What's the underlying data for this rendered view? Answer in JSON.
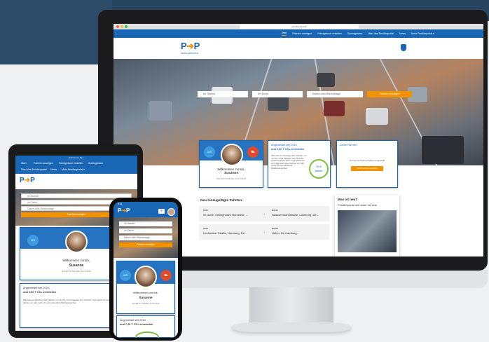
{
  "colors": {
    "brand_blue": "#1967b4",
    "accent_orange": "#f39200",
    "eco_green": "#7cbf3a"
  },
  "desktop": {
    "url": "pendlerportal.de",
    "nav": [
      "Start",
      "Fahrten anzeigen",
      "Fahrtgesuch erstellen",
      "Suchagenten",
      "Über das Pendlerportal",
      "News",
      "Mein Pendlerportal ▾"
    ],
    "logo": {
      "text_left": "P",
      "text_arrow": "➔",
      "text_right": "P",
      "sub": "PENDLERPORTAL"
    },
    "search": {
      "from_placeholder": "Ihr Startort",
      "to_placeholder": "Ihr Zielort",
      "date_placeholder": "Datum oder Wochentage",
      "button": "Fahrten anzeigen"
    },
    "welcome": {
      "greeting": "Willkommen zurück,",
      "name": "Susanne",
      "last_online": "ZULETZT ONLINE: 22.10.2019"
    },
    "eco": {
      "line1": "Angemeldet seit 2016",
      "line2": "und 0,00 T CO₂ vermieden",
      "body": "Was hast du zukünftig mehr Fahrten, um mit CO₂ zu für tätigsten zum Verzeiht jemals verfolgen kann. Lege gleich los und trage beim einer Fahrten ein oder suche dir eine passende Mitfahrgelegenheit.",
      "circle_top": "2019",
      "circle_bottom": "starten"
    },
    "my_trips": {
      "title": "Deine Fahrten",
      "empty": "Zu has noch keine Fahrten eingestellt",
      "button": "2019 Fahrten erstellen"
    },
    "new_trips": {
      "title": "Neu hinzugefügte Fahrten:",
      "rows": [
        {
          "from_label": "VON",
          "from": "im Dorfe, Kellinghusen Barnstedt, ...",
          "to_label": "NACH",
          "to": "Strassenmannstraße, Lüneburg, De..."
        },
        {
          "from_label": "VON",
          "from": "Lindholmer Straße, Hamburg, De...",
          "to_label": "NACH",
          "to": "Hafen, De Hamburg..."
        }
      ]
    },
    "news": {
      "title": "Was ist neu?",
      "headline": "Pendlerportal mit neuer Version"
    }
  },
  "tablet": {
    "time": "9:41 Di. 11. Dez.",
    "nav": [
      "Start",
      "Fahrten anzeigen",
      "Fahrtgesuch erstellen",
      "Suchagenten"
    ],
    "nav2": [
      "Über das Pendlerportal",
      "News",
      "Mein Pendlerportal ▾"
    ],
    "from_placeholder": "Ihr Startort",
    "to_placeholder": "Ihr Zielort",
    "date_placeholder": "Datum oder Wochentage",
    "button": "Fahrten anzeigen",
    "greeting": "Willkommen zurück,",
    "name": "Susanne",
    "last_online": "ZULETZT ONLINE: 22.10.2019",
    "eco_line1": "Angemeldet seit 2016",
    "eco_line2": "und 0,00 T CO₂ vermieden",
    "eco_body": "Was hast du zukünftig mehr Fahrten, um mit CO₂ zu für tätigsten zum Verzeiht. Lege gleich los und trage beim einer Fahrten ein oder suche dir eine passende Mitfahrgelegenheit."
  },
  "phone": {
    "time": "9:41",
    "from_placeholder": "Ihr Startort",
    "to_placeholder": "Ihr Zielort",
    "date_placeholder": "Datum oder Wochentage",
    "button": "Fahrten anzeigen",
    "greeting": "Willkommen zurück,",
    "name": "Susanne",
    "last_online": "ZULETZT ONLINE: 20.09.2019",
    "eco_line1": "Angemeldet seit 2013",
    "eco_line2": "und 7,26 T CO₂ vermieden"
  }
}
